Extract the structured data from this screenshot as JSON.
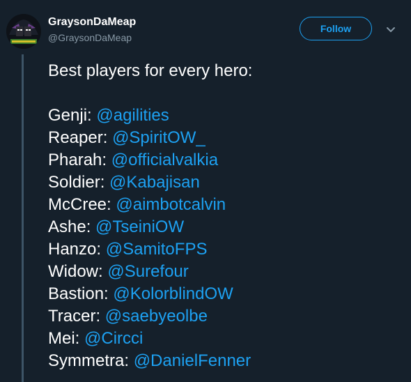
{
  "author": {
    "display_name": "GraysonDaMeap",
    "handle": "@GraysonDaMeap"
  },
  "actions": {
    "follow_label": "Follow"
  },
  "tweet": {
    "intro": "Best players for every hero:",
    "lines": [
      {
        "hero": "Genji:",
        "mention": "@agilities"
      },
      {
        "hero": "Reaper:",
        "mention": "@SpiritOW_"
      },
      {
        "hero": "Pharah:",
        "mention": "@officialvalkia"
      },
      {
        "hero": "Soldier:",
        "mention": "@Kabajisan"
      },
      {
        "hero": "McCree:",
        "mention": "@aimbotcalvin"
      },
      {
        "hero": "Ashe:",
        "mention": "@TseiniOW"
      },
      {
        "hero": "Hanzo:",
        "mention": "@SamitoFPS"
      },
      {
        "hero": "Widow:",
        "mention": "@Surefour"
      },
      {
        "hero": "Bastion:",
        "mention": "@KolorblindOW"
      },
      {
        "hero": "Tracer:",
        "mention": "@saebyeolbe"
      },
      {
        "hero": "Mei:",
        "mention": "@Circci"
      },
      {
        "hero": "Symmetra:",
        "mention": "@DanielFenner"
      }
    ]
  },
  "colors": {
    "background": "#15202b",
    "accent": "#1da1f2",
    "secondary_text": "#8899a6",
    "thread_line": "#3d5466"
  },
  "icons": {
    "avatar": "avatar-image",
    "caret": "chevron-down-icon"
  }
}
